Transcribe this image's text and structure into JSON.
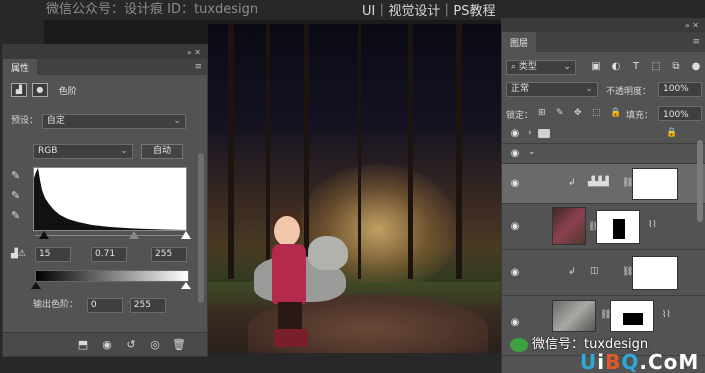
{
  "watermark_top": "微信公众号：设计痕  ID：tuxdesign",
  "tagline": "UI｜视觉设计｜PS教程",
  "properties": {
    "tab": "属性",
    "adjust_label": "色阶",
    "preset_label": "预设：",
    "preset_value": "自定",
    "channel_value": "RGB",
    "auto_label": "自动",
    "input_black": "15",
    "input_gamma": "0.71",
    "input_white": "255",
    "output_label": "输出色阶：",
    "output_black": "0",
    "output_white": "255"
  },
  "layers": {
    "tab": "图层",
    "filter_label": "类型",
    "blend_mode": "正常",
    "opacity_label": "不透明度：",
    "opacity_value": "100%",
    "lock_label": "锁定：",
    "fill_label": "填充：",
    "fill_value": "100%"
  },
  "watermark_wechat": "微信号：tuxdesign",
  "watermark_site": {
    "a": "U",
    "b": "i",
    "c": "B",
    "d": "Q",
    "rest": ".CoM"
  }
}
